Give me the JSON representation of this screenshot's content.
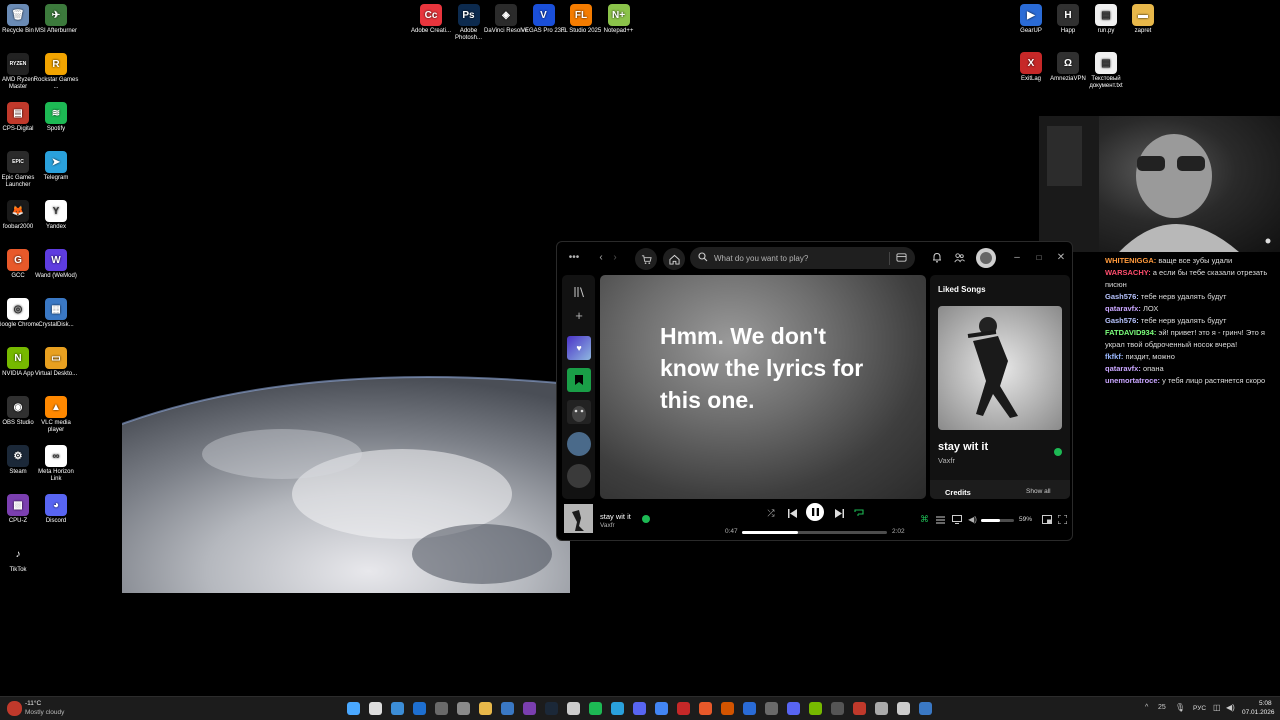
{
  "desktop": {
    "left_icons": [
      {
        "label": "Recycle Bin",
        "color": "#6a8bb5",
        "glyph": "🗑"
      },
      {
        "label": "MSI Afterburner",
        "color": "#3c7a3c",
        "glyph": "✈"
      },
      {
        "label": "AMD Ryzen Master",
        "color": "#222222",
        "glyph": "RYZEN"
      },
      {
        "label": "Rockstar Games ...",
        "color": "#f2a400",
        "glyph": "R"
      },
      {
        "label": "CPS-Digital",
        "color": "#c0392b",
        "glyph": "▤"
      },
      {
        "label": "Spotify",
        "color": "#1db954",
        "glyph": "≋"
      },
      {
        "label": "Epic Games Launcher",
        "color": "#2a2a2a",
        "glyph": "EPIC"
      },
      {
        "label": "Telegram",
        "color": "#2aa1dc",
        "glyph": "➤"
      },
      {
        "label": "foobar2000",
        "color": "#1a1a1a",
        "glyph": "🦊"
      },
      {
        "label": "Yandex",
        "color": "#ffffff",
        "glyph": "Y"
      },
      {
        "label": "GCC",
        "color": "#e8592a",
        "glyph": "G"
      },
      {
        "label": "Wand (WeMod)",
        "color": "#5e3ce0",
        "glyph": "W"
      },
      {
        "label": "Google Chrome",
        "color": "#ffffff",
        "glyph": "◎"
      },
      {
        "label": "CrystalDisk...",
        "color": "#3a78c4",
        "glyph": "▦"
      },
      {
        "label": "NVIDIA App",
        "color": "#76b900",
        "glyph": "N"
      },
      {
        "label": "Virtual Deskto...",
        "color": "#e8a020",
        "glyph": "▭"
      },
      {
        "label": "OBS Studio",
        "color": "#303030",
        "glyph": "◉"
      },
      {
        "label": "VLC media player",
        "color": "#ff8800",
        "glyph": "▲"
      },
      {
        "label": "Steam",
        "color": "#1b2838",
        "glyph": "⚙"
      },
      {
        "label": "Meta Horizon Link",
        "color": "#ffffff",
        "glyph": "∞"
      },
      {
        "label": "CPU-Z",
        "color": "#7b3fb0",
        "glyph": "▩"
      },
      {
        "label": "Discord",
        "color": "#5865f2",
        "glyph": "◕"
      },
      {
        "label": "TikTok",
        "color": "#000000",
        "glyph": "♪"
      }
    ],
    "top_icons": [
      {
        "label": "Adobe Creati...",
        "color": "#e8353d",
        "glyph": "Cc"
      },
      {
        "label": "Adobe Photosh...",
        "color": "#0c2a4e",
        "glyph": "Ps"
      },
      {
        "label": "DaVinci Resolve",
        "color": "#2b2b2b",
        "glyph": "◈"
      },
      {
        "label": "VEGAS Pro 23.0",
        "color": "#1a4fd8",
        "glyph": "V"
      },
      {
        "label": "FL Studio 2025",
        "color": "#f57c00",
        "glyph": "FL"
      },
      {
        "label": "Notepad++",
        "color": "#8bc34a",
        "glyph": "N+"
      }
    ],
    "right_icons": [
      {
        "label": "GearUP",
        "color": "#2a6bd6",
        "glyph": "▶"
      },
      {
        "label": "Happ",
        "color": "#303030",
        "glyph": "H"
      },
      {
        "label": "run.py",
        "color": "#f0f0f0",
        "glyph": "▤"
      },
      {
        "label": "zapret",
        "color": "#e8b84a",
        "glyph": "▬"
      },
      {
        "label": "ExitLag",
        "color": "#c62828",
        "glyph": "X"
      },
      {
        "label": "AmneziaVPN",
        "color": "#303030",
        "glyph": "Ω"
      },
      {
        "label": "Текстовый документ.txt",
        "color": "#f0f0f0",
        "glyph": "▤"
      }
    ]
  },
  "spotify": {
    "search_placeholder": "What do you want to play?",
    "lyrics_message": "Hmm. We don't know the lyrics for this one.",
    "right_panel": {
      "title": "Liked Songs",
      "track_title": "stay wit it",
      "artist": "Vaxfr",
      "credits_label": "Credits",
      "show_all_label": "Show all"
    },
    "now_playing": {
      "title": "stay wit it",
      "artist": "Vaxfr",
      "elapsed": "0:47",
      "duration": "2:02",
      "progress": 0.385,
      "volume": "59%",
      "volume_level": 0.59
    },
    "colors": {
      "accent": "#1db954"
    }
  },
  "chat": [
    {
      "user": "WHITENIGGA:",
      "text": "ваще все зубы удали",
      "color": "#ff9a3c"
    },
    {
      "user": "WARSACHY:",
      "text": "а если бы тебе сказали отрезать писюн",
      "color": "#ff4d6d"
    },
    {
      "user": "Gash576:",
      "text": "тебе нерв удалять будут",
      "color": "#b8c4ff"
    },
    {
      "user": "qataravfx:",
      "text": "ЛОХ",
      "color": "#c9a6ff"
    },
    {
      "user": "Gash576:",
      "text": "тебе нерв удалять будут",
      "color": "#b8c4ff"
    },
    {
      "user": "FATDAVID934:",
      "text": "эй! привет! это я - гринч! Это я украл твой обдроченный носок вчера!",
      "color": "#7cff7c"
    },
    {
      "user": "fkfkf:",
      "text": "пиздит, можно",
      "color": "#9ab8ff"
    },
    {
      "user": "qataravfx:",
      "text": "опана",
      "color": "#c9a6ff"
    },
    {
      "user": "unemortatroce:",
      "text": "у тебя лицо растянется скоро",
      "color": "#c9a6ff"
    }
  ],
  "taskbar": {
    "weather_temp": "-11°C",
    "weather_desc": "Mostly cloudy",
    "volume_num": "25",
    "lang": "РУС",
    "time": "5:08",
    "date": "07.01.2026"
  }
}
